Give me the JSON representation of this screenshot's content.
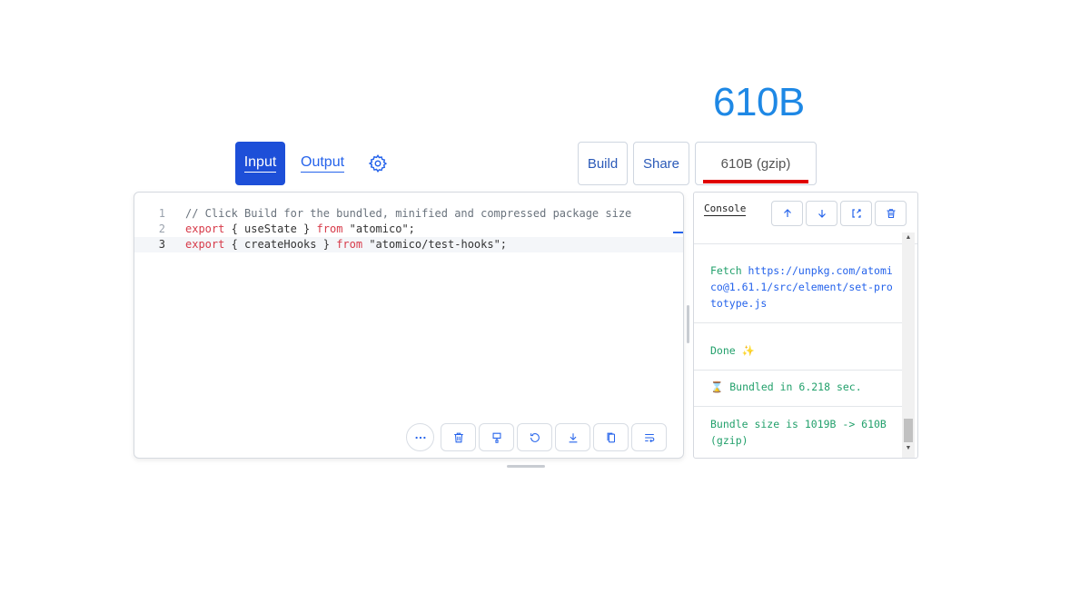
{
  "header": {
    "size_display": "610B"
  },
  "tabs": {
    "input": "Input",
    "output": "Output"
  },
  "toolbar": {
    "build": "Build",
    "share": "Share",
    "size_gzip": "610B (gzip)"
  },
  "editor": {
    "lines": [
      {
        "num": "1",
        "comment": "// Click Build for the bundled, minified and compressed package size"
      },
      {
        "num": "2",
        "kw1": "export",
        "p1": " { useState } ",
        "kw2": "from",
        "p2": " \"atomico\";"
      },
      {
        "num": "3",
        "kw1": "export",
        "p1": " { createHooks } ",
        "kw2": "from",
        "p2": " \"atomico/test-hooks\";"
      }
    ]
  },
  "console": {
    "title": "Console",
    "logs": [
      {
        "prefix": "Fetch ",
        "url": "https://unpkg.com/atomico@1.61.1/src/element/set-prototype.js"
      },
      {
        "text": "Done ✨"
      },
      {
        "text": "⌛ Bundled in 6.218 sec."
      },
      {
        "text": "Bundle size is 1019B -> 610B (gzip)"
      }
    ]
  },
  "colors": {
    "primary": "#1d4fd8",
    "accent_blue": "#1e88e5",
    "success_green": "#22a06b",
    "keyword_red": "#d73a49",
    "highlight_red": "#e00000"
  },
  "icons": [
    "settings-gear-icon",
    "more-icon",
    "trash-icon",
    "format-icon",
    "reset-icon",
    "download-icon",
    "copy-icon",
    "wrap-icon",
    "arrow-up-icon",
    "arrow-down-icon",
    "expand-icon",
    "clear-icon"
  ]
}
